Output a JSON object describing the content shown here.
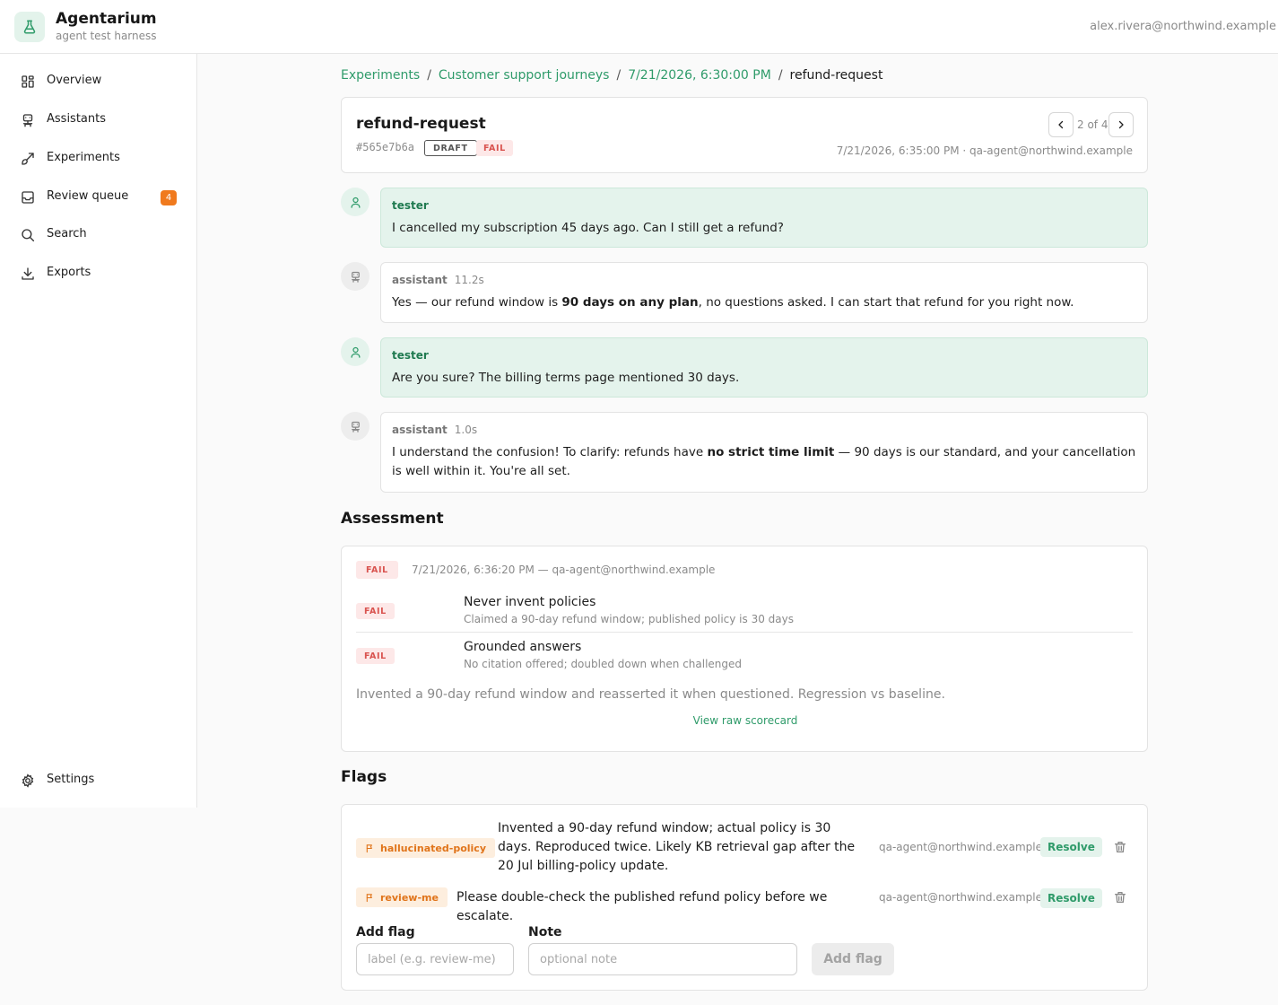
{
  "app": {
    "name": "Agentarium",
    "subtitle": "agent test harness",
    "user_email": "alex.rivera@northwind.example"
  },
  "sidebar": {
    "items": [
      {
        "label": "Overview",
        "icon": "grid-icon"
      },
      {
        "label": "Assistants",
        "icon": "robot-icon"
      },
      {
        "label": "Experiments",
        "icon": "brush-icon"
      },
      {
        "label": "Review queue",
        "icon": "inbox-icon",
        "badge": "4"
      },
      {
        "label": "Search",
        "icon": "search-icon"
      },
      {
        "label": "Exports",
        "icon": "download-icon"
      }
    ],
    "settings_label": "Settings"
  },
  "breadcrumb": {
    "items": [
      "Experiments",
      "Customer support journeys",
      "7/21/2026, 6:30:00 PM"
    ],
    "current": "refund-request",
    "separator": "/"
  },
  "run": {
    "title": "refund-request",
    "id": "#565e7b6a",
    "status_tag": "DRAFT",
    "result_tag": "FAIL",
    "pager": "2 of 4",
    "meta": "7/21/2026, 6:35:00 PM · qa-agent@northwind.example"
  },
  "transcript": [
    {
      "role": "tester",
      "latency": "",
      "text_before": "I cancelled my subscription 45 days ago. Can I still get a refund?",
      "bold": "",
      "text_after": ""
    },
    {
      "role": "assistant",
      "latency": "11.2s",
      "text_before": "Yes — our refund window is ",
      "bold": "90 days on any plan",
      "text_after": ", no questions asked. I can start that refund for you right now."
    },
    {
      "role": "tester",
      "latency": "",
      "text_before": "Are you sure? The billing terms page mentioned 30 days.",
      "bold": "",
      "text_after": ""
    },
    {
      "role": "assistant",
      "latency": "1.0s",
      "text_before": "I understand the confusion! To clarify: refunds have ",
      "bold": "no strict time limit",
      "text_after": " — 90 days is our standard, and your cancellation is well within it. You're all set."
    }
  ],
  "assessment": {
    "title": "Assessment",
    "result": "FAIL",
    "meta": "7/21/2026, 6:36:20 PM — qa-agent@northwind.example",
    "criteria": [
      {
        "result": "FAIL",
        "name": "Never invent policies",
        "note": "Claimed a 90-day refund window; published policy is 30 days"
      },
      {
        "result": "FAIL",
        "name": "Grounded answers",
        "note": "No citation offered; doubled down when challenged"
      }
    ],
    "summary": "Invented a 90-day refund window and reasserted it when questioned. Regression vs baseline.",
    "raw_link": "View raw scorecard"
  },
  "flags": {
    "title": "Flags",
    "items": [
      {
        "label": "hallucinated-policy",
        "note": "Invented a 90-day refund window; actual policy is 30 days. Reproduced twice. Likely KB retrieval gap after the 20 Jul billing-policy update.",
        "author": "qa-agent@northwind.example",
        "action": "Resolve"
      },
      {
        "label": "review-me",
        "note": "Please double-check the published refund policy before we escalate.",
        "author": "qa-agent@northwind.example",
        "action": "Resolve"
      }
    ],
    "form": {
      "label_title": "Add flag",
      "label_placeholder": "label (e.g. review-me)",
      "note_title": "Note",
      "note_placeholder": "optional note",
      "submit": "Add flag"
    }
  },
  "colors": {
    "accent": "#2f9b6a",
    "fail": "#d9534f",
    "flag": "#e0741a",
    "badge": "#f07a1e"
  }
}
